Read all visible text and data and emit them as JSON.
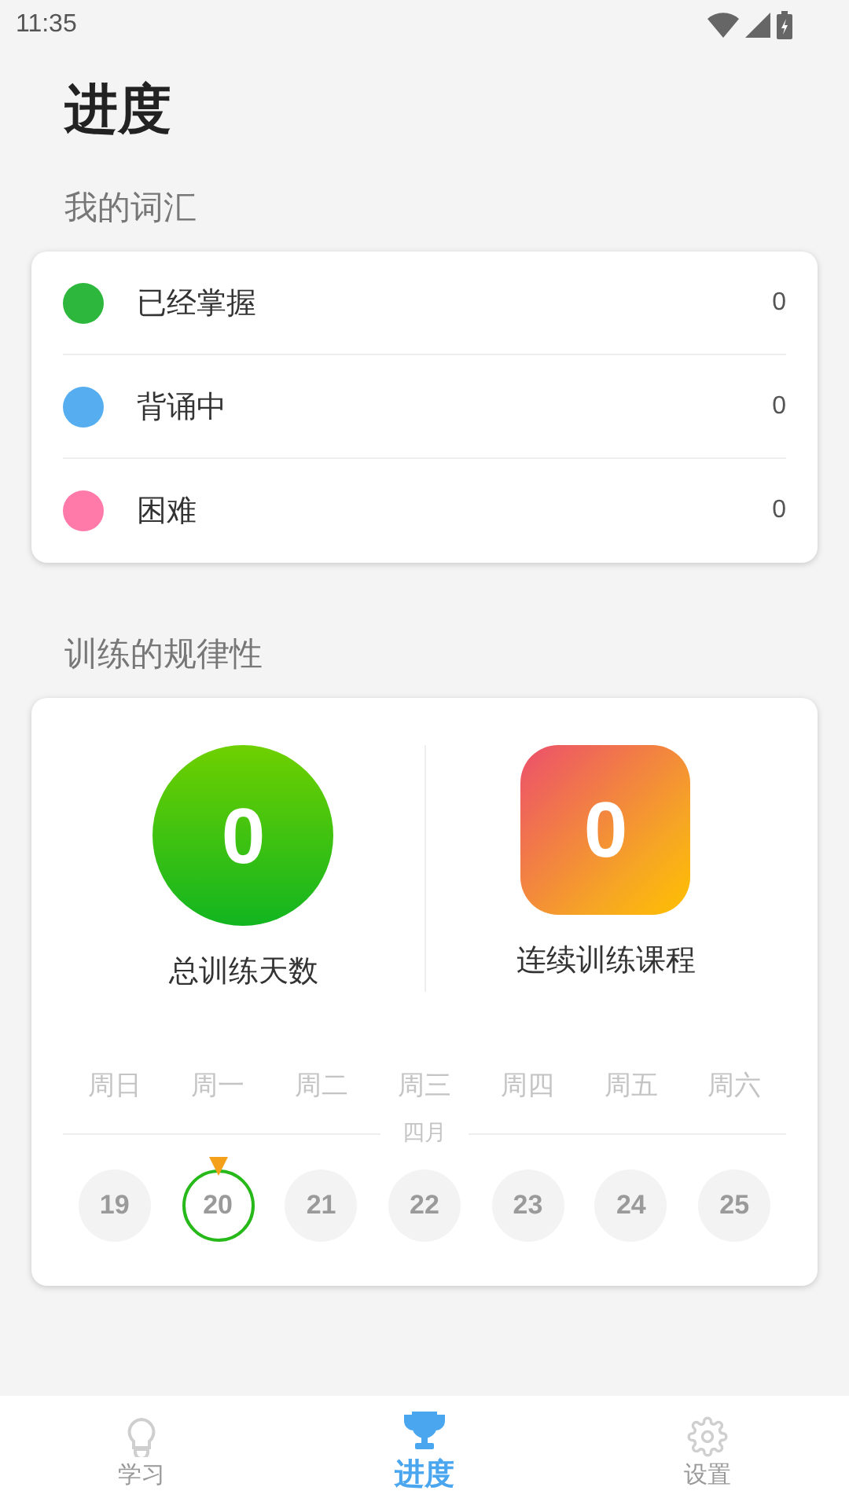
{
  "status_bar": {
    "time": "11:35"
  },
  "title": "进度",
  "vocabulary": {
    "heading": "我的词汇",
    "items": [
      {
        "label": "已经掌握",
        "count": "0",
        "color": "#2db83d"
      },
      {
        "label": "背诵中",
        "count": "0",
        "color": "#56aef0"
      },
      {
        "label": "困难",
        "count": "0",
        "color": "#ff7aa8"
      }
    ]
  },
  "regularity": {
    "heading": "训练的规律性",
    "stats": [
      {
        "kind": "circle",
        "value": "0",
        "label": "总训练天数"
      },
      {
        "kind": "square",
        "value": "0",
        "label": "连续训练课程"
      }
    ],
    "weekdays": [
      "周日",
      "周一",
      "周二",
      "周三",
      "周四",
      "周五",
      "周六"
    ],
    "month": "四月",
    "days": [
      {
        "label": "19",
        "selected": false
      },
      {
        "label": "20",
        "selected": true
      },
      {
        "label": "21",
        "selected": false
      },
      {
        "label": "22",
        "selected": false
      },
      {
        "label": "23",
        "selected": false
      },
      {
        "label": "24",
        "selected": false
      },
      {
        "label": "25",
        "selected": false
      }
    ]
  },
  "nav": [
    {
      "kind": "bulb",
      "label": "学习",
      "selected": false
    },
    {
      "kind": "trophy",
      "label": "进度",
      "selected": true
    },
    {
      "kind": "gear",
      "label": "设置",
      "selected": false
    }
  ]
}
